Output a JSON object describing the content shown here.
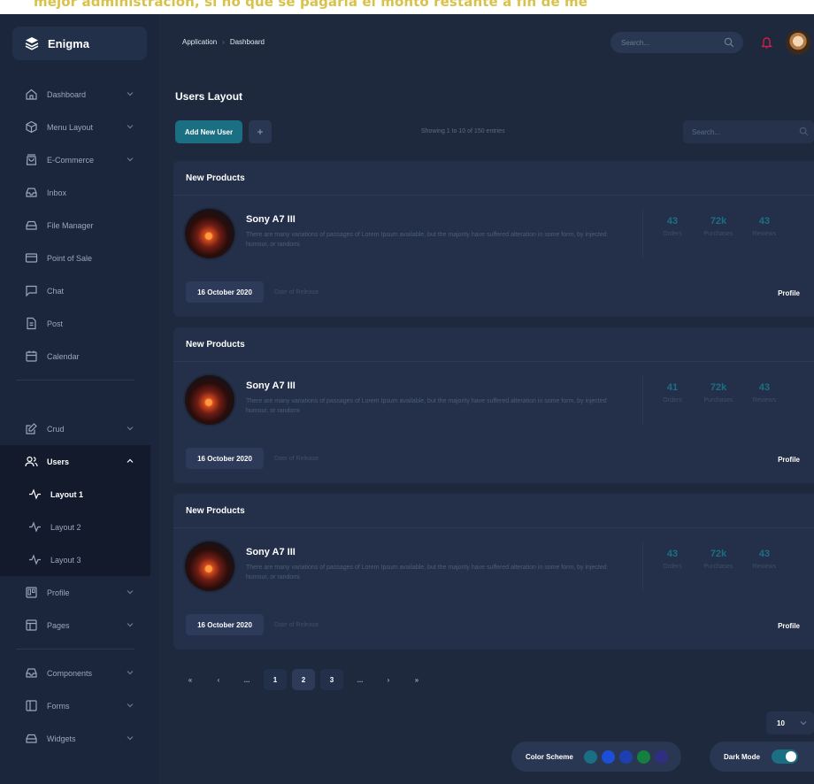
{
  "caption": "mejor administración, si no que se pagaría el monto restante a fin de me",
  "brand": {
    "name": "Enigma"
  },
  "sidebar": {
    "items": [
      {
        "label": "Dashboard",
        "icon": "home-icon",
        "chevron": true
      },
      {
        "label": "Menu Layout",
        "icon": "box-icon",
        "chevron": true
      },
      {
        "label": "E-Commerce",
        "icon": "shopping-bag-icon",
        "chevron": true
      },
      {
        "label": "Inbox",
        "icon": "inbox-icon",
        "chevron": false
      },
      {
        "label": "File Manager",
        "icon": "hard-drive-icon",
        "chevron": false
      },
      {
        "label": "Point of Sale",
        "icon": "credit-card-icon",
        "chevron": false
      },
      {
        "label": "Chat",
        "icon": "message-square-icon",
        "chevron": false
      },
      {
        "label": "Post",
        "icon": "file-text-icon",
        "chevron": false
      },
      {
        "label": "Calendar",
        "icon": "calendar-icon",
        "chevron": false
      }
    ],
    "items2": [
      {
        "label": "Crud",
        "icon": "edit-icon",
        "chevron": true
      },
      {
        "label": "Users",
        "icon": "users-icon",
        "chevron": true
      }
    ],
    "users_sub": [
      {
        "label": "Layout 1"
      },
      {
        "label": "Layout 2"
      },
      {
        "label": "Layout 3"
      }
    ],
    "items3": [
      {
        "label": "Profile",
        "icon": "trello-icon",
        "chevron": true
      },
      {
        "label": "Pages",
        "icon": "layout-icon",
        "chevron": true
      }
    ],
    "items4": [
      {
        "label": "Components",
        "icon": "inbox-icon",
        "chevron": true
      },
      {
        "label": "Forms",
        "icon": "sidebar-icon",
        "chevron": true
      },
      {
        "label": "Widgets",
        "icon": "hard-drive-icon",
        "chevron": true
      }
    ]
  },
  "header": {
    "breadcrumb": [
      "Application",
      "Dashboard"
    ],
    "search_placeholder": "Search..."
  },
  "main": {
    "title": "Users Layout",
    "add_button": "Add New User",
    "plus_button": "+",
    "entries_text": "Showing 1 to 10 of 150 entries",
    "search_placeholder": "Search...",
    "cards": [
      {
        "heading": "New Products",
        "product": "Sony A7 III",
        "description": "There are many variations of passages of Lorem Ipsum available, but the majority have suffered alteration in some form, by injected humour, or randomi",
        "stats": [
          {
            "value": "43",
            "label": "Orders"
          },
          {
            "value": "72k",
            "label": "Purchases"
          },
          {
            "value": "43",
            "label": "Reviews"
          }
        ],
        "date": "16 October 2020",
        "date_label": "Date of Release",
        "profile": "Profile"
      },
      {
        "heading": "New Products",
        "product": "Sony A7 III",
        "description": "There are many variations of passages of Lorem Ipsum available, but the majority have suffered alteration in some form, by injected humour, or randomi",
        "stats": [
          {
            "value": "41",
            "label": "Orders"
          },
          {
            "value": "72k",
            "label": "Purchases"
          },
          {
            "value": "43",
            "label": "Reviews"
          }
        ],
        "date": "16 October 2020",
        "date_label": "Date of Release",
        "profile": "Profile"
      },
      {
        "heading": "New Products",
        "product": "Sony A7 III",
        "description": "There are many variations of passages of Lorem Ipsum available, but the majority have suffered alteration in some form, by injected humour, or randomi",
        "stats": [
          {
            "value": "43",
            "label": "Orders"
          },
          {
            "value": "72k",
            "label": "Purchases"
          },
          {
            "value": "43",
            "label": "Reviews"
          }
        ],
        "date": "16 October 2020",
        "date_label": "Date of Release",
        "profile": "Profile"
      }
    ],
    "pagination": [
      "«",
      "‹",
      "...",
      "1",
      "2",
      "3",
      "...",
      "›",
      "»"
    ],
    "pagination_active": "2",
    "per_page": "10"
  },
  "footer": {
    "color_scheme_label": "Color Scheme",
    "swatches": [
      "#1b6f82",
      "#1d4ed8",
      "#1e40af",
      "#15803d",
      "#312e81"
    ],
    "dark_mode_label": "Dark Mode"
  },
  "colors": {
    "accent": "#1b6f82",
    "background": "#1e293e",
    "notification": "#e11d48"
  }
}
